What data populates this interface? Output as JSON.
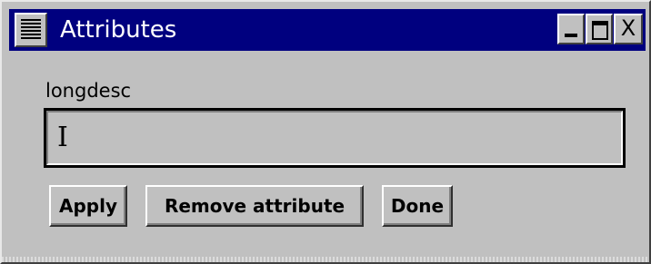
{
  "window": {
    "title": "Attributes",
    "title_bar_color": "#00007f",
    "controls": {
      "menu_icon": "window-menu-icon",
      "minimize_icon": "minimize-icon",
      "maximize_icon": "maximize-icon",
      "close_icon": "close-icon",
      "close_glyph": "X"
    }
  },
  "form": {
    "field_label": "longdesc",
    "field_value": "",
    "cursor_icon": "text-cursor-icon",
    "cursor_glyph": "I"
  },
  "buttons": {
    "apply": "Apply",
    "remove_attribute": "Remove attribute",
    "done": "Done"
  }
}
